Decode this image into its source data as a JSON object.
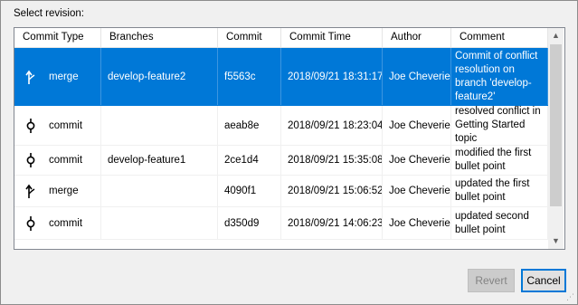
{
  "dialog": {
    "prompt": "Select revision:",
    "revert_label": "Revert",
    "cancel_label": "Cancel"
  },
  "table": {
    "headers": [
      "Commit Type",
      "Branches",
      "Commit",
      "Commit Time",
      "Author",
      "Comment"
    ],
    "rows": [
      {
        "type": "merge",
        "icon": "merge-icon",
        "branch": "develop-feature2",
        "commit": "f5563c",
        "time": "2018/09/21 18:31:17",
        "author": "Joe Cheverie",
        "comment": "Commit of conflict resolution on branch 'develop-feature2'",
        "selected": true
      },
      {
        "type": "commit",
        "icon": "commit-icon",
        "branch": "",
        "commit": "aeab8e",
        "time": "2018/09/21 18:23:04",
        "author": "Joe Cheverie",
        "comment": "resolved conflict in Getting Started topic",
        "selected": false
      },
      {
        "type": "commit",
        "icon": "commit-icon",
        "branch": "develop-feature1",
        "commit": "2ce1d4",
        "time": "2018/09/21 15:35:08",
        "author": "Joe Cheverie",
        "comment": "modified the first bullet point",
        "selected": false
      },
      {
        "type": "merge",
        "icon": "merge-icon",
        "branch": "",
        "commit": "4090f1",
        "time": "2018/09/21 15:06:52",
        "author": "Joe Cheverie",
        "comment": " updated the first bullet point",
        "selected": false
      },
      {
        "type": "commit",
        "icon": "commit-icon",
        "branch": "",
        "commit": "d350d9",
        "time": "2018/09/21 14:06:23",
        "author": "Joe Cheverie",
        "comment": "updated second bullet point",
        "selected": false
      }
    ]
  },
  "colors": {
    "selection": "#0078d7",
    "button_focus": "#0078d7"
  }
}
